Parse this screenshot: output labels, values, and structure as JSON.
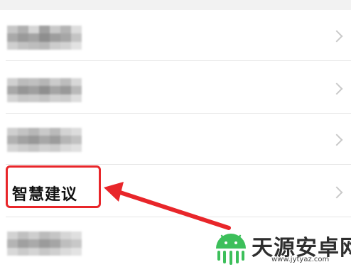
{
  "settings_list": {
    "rows": [
      {
        "label": "",
        "redacted": true
      },
      {
        "label": "",
        "redacted": true
      },
      {
        "label": "",
        "redacted": true
      },
      {
        "label": "智慧建议",
        "redacted": false,
        "highlighted": true
      },
      {
        "label": "",
        "redacted": true
      }
    ],
    "chevron_icon": "chevron-right-icon"
  },
  "annotation": {
    "highlight_color": "#e8262a",
    "arrow_icon": "red-arrow-icon"
  },
  "watermark": {
    "title": "天源安卓网",
    "url": "www.jytyaz.com",
    "logo_icon": "android-logo-icon",
    "logo_color": "#3cbf5a"
  },
  "colors": {
    "background": "#f2f2f2",
    "list_background": "#ffffff",
    "divider": "#e6e6e6",
    "chevron": "#c9c9c9",
    "text": "#111111"
  }
}
